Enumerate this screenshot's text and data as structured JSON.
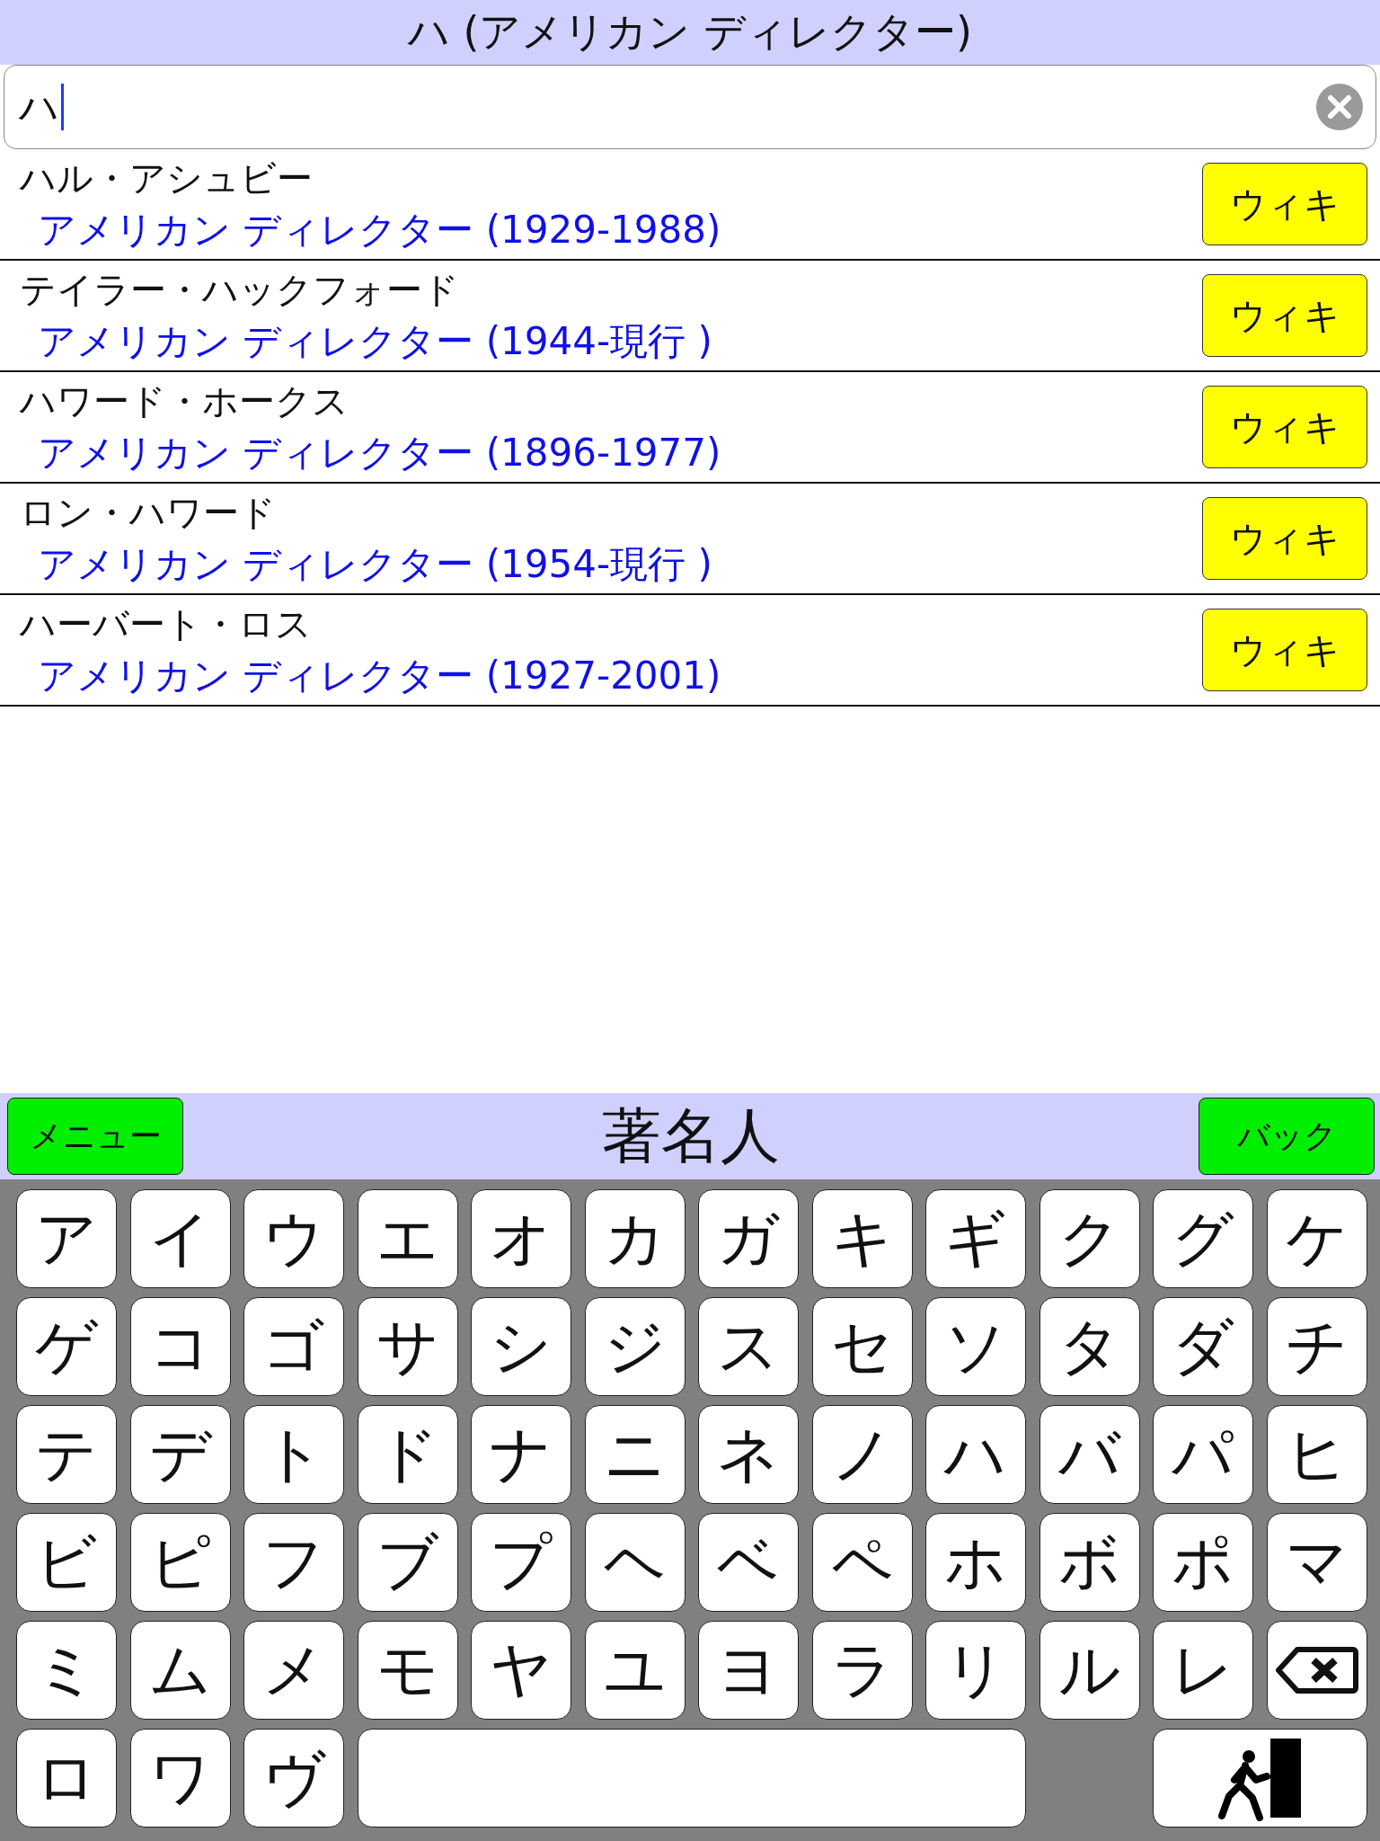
{
  "title": "ハ (アメリカン ディレクター)",
  "search": {
    "value": "ハ"
  },
  "results": [
    {
      "name": "ハル・アシュビー",
      "detail": "アメリカン ディレクター (1929-1988)",
      "button": "ウィキ"
    },
    {
      "name": "テイラー・ハックフォード",
      "detail": "アメリカン ディレクター (1944-現行 )",
      "button": "ウィキ"
    },
    {
      "name": "ハワード・ホークス",
      "detail": "アメリカン ディレクター (1896-1977)",
      "button": "ウィキ"
    },
    {
      "name": "ロン・ハワード",
      "detail": "アメリカン ディレクター (1954-現行 )",
      "button": "ウィキ"
    },
    {
      "name": "ハーバート・ロス",
      "detail": "アメリカン ディレクター (1927-2001)",
      "button": "ウィキ"
    }
  ],
  "nav": {
    "menu": "メニュー",
    "title": "著名人",
    "back": "バック"
  },
  "keyboard": [
    [
      {
        "kind": "char",
        "label": "ア"
      },
      {
        "kind": "char",
        "label": "イ"
      },
      {
        "kind": "char",
        "label": "ウ"
      },
      {
        "kind": "char",
        "label": "エ"
      },
      {
        "kind": "char",
        "label": "オ"
      },
      {
        "kind": "char",
        "label": "カ"
      },
      {
        "kind": "char",
        "label": "ガ"
      },
      {
        "kind": "char",
        "label": "キ"
      },
      {
        "kind": "char",
        "label": "ギ"
      },
      {
        "kind": "char",
        "label": "ク"
      },
      {
        "kind": "char",
        "label": "グ"
      },
      {
        "kind": "char",
        "label": "ケ"
      }
    ],
    [
      {
        "kind": "char",
        "label": "ゲ"
      },
      {
        "kind": "char",
        "label": "コ"
      },
      {
        "kind": "char",
        "label": "ゴ"
      },
      {
        "kind": "char",
        "label": "サ"
      },
      {
        "kind": "char",
        "label": "シ"
      },
      {
        "kind": "char",
        "label": "ジ"
      },
      {
        "kind": "char",
        "label": "ス"
      },
      {
        "kind": "char",
        "label": "セ"
      },
      {
        "kind": "char",
        "label": "ソ"
      },
      {
        "kind": "char",
        "label": "タ"
      },
      {
        "kind": "char",
        "label": "ダ"
      },
      {
        "kind": "char",
        "label": "チ"
      }
    ],
    [
      {
        "kind": "char",
        "label": "テ"
      },
      {
        "kind": "char",
        "label": "デ"
      },
      {
        "kind": "char",
        "label": "ト"
      },
      {
        "kind": "char",
        "label": "ド"
      },
      {
        "kind": "char",
        "label": "ナ"
      },
      {
        "kind": "char",
        "label": "ニ"
      },
      {
        "kind": "char",
        "label": "ネ"
      },
      {
        "kind": "char",
        "label": "ノ"
      },
      {
        "kind": "char",
        "label": "ハ"
      },
      {
        "kind": "char",
        "label": "バ"
      },
      {
        "kind": "char",
        "label": "パ"
      },
      {
        "kind": "char",
        "label": "ヒ"
      }
    ],
    [
      {
        "kind": "char",
        "label": "ビ"
      },
      {
        "kind": "char",
        "label": "ピ"
      },
      {
        "kind": "char",
        "label": "フ"
      },
      {
        "kind": "char",
        "label": "ブ"
      },
      {
        "kind": "char",
        "label": "プ"
      },
      {
        "kind": "char",
        "label": "ヘ"
      },
      {
        "kind": "char",
        "label": "ベ"
      },
      {
        "kind": "char",
        "label": "ペ"
      },
      {
        "kind": "char",
        "label": "ホ"
      },
      {
        "kind": "char",
        "label": "ボ"
      },
      {
        "kind": "char",
        "label": "ポ"
      },
      {
        "kind": "char",
        "label": "マ"
      }
    ],
    [
      {
        "kind": "char",
        "label": "ミ"
      },
      {
        "kind": "char",
        "label": "ム"
      },
      {
        "kind": "char",
        "label": "メ"
      },
      {
        "kind": "char",
        "label": "モ"
      },
      {
        "kind": "char",
        "label": "ヤ"
      },
      {
        "kind": "char",
        "label": "ユ"
      },
      {
        "kind": "char",
        "label": "ヨ"
      },
      {
        "kind": "char",
        "label": "ラ"
      },
      {
        "kind": "char",
        "label": "リ"
      },
      {
        "kind": "char",
        "label": "ル"
      },
      {
        "kind": "char",
        "label": "レ"
      },
      {
        "kind": "backspace"
      }
    ],
    [
      {
        "kind": "char",
        "label": "ロ"
      },
      {
        "kind": "char",
        "label": "ワ"
      },
      {
        "kind": "char",
        "label": "ヴ"
      },
      {
        "kind": "space"
      },
      {
        "kind": "exit"
      }
    ]
  ]
}
